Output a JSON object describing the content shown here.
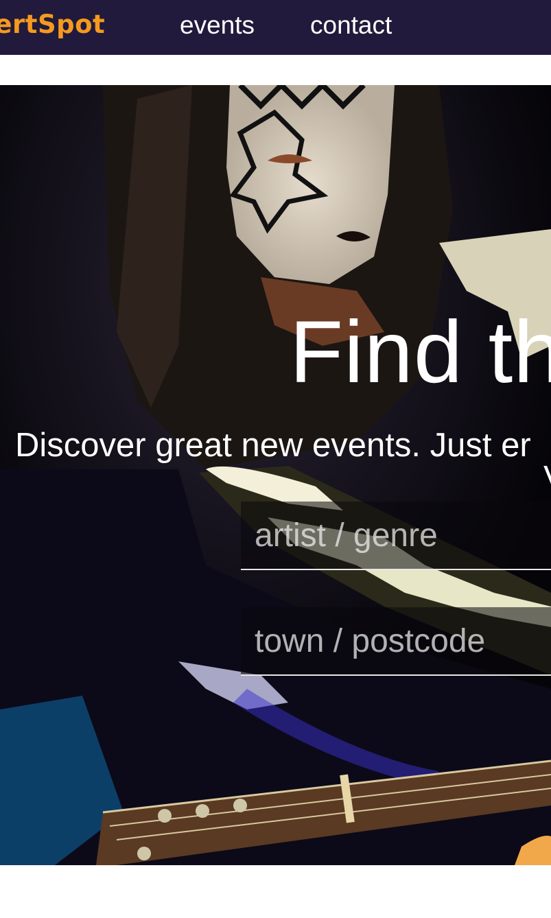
{
  "nav": {
    "logo": "certSpot",
    "links": [
      {
        "label": "events"
      },
      {
        "label": "contact"
      }
    ]
  },
  "hero": {
    "headline": "Find th",
    "subline": "Discover great new events. Just er",
    "subline_overflow": "V",
    "search": {
      "artist_placeholder": "artist / genre",
      "town_placeholder": "town / postcode"
    }
  },
  "colors": {
    "nav_background": "#221a3c",
    "logo": "#f49a1f",
    "hero_text": "#ffffff"
  }
}
